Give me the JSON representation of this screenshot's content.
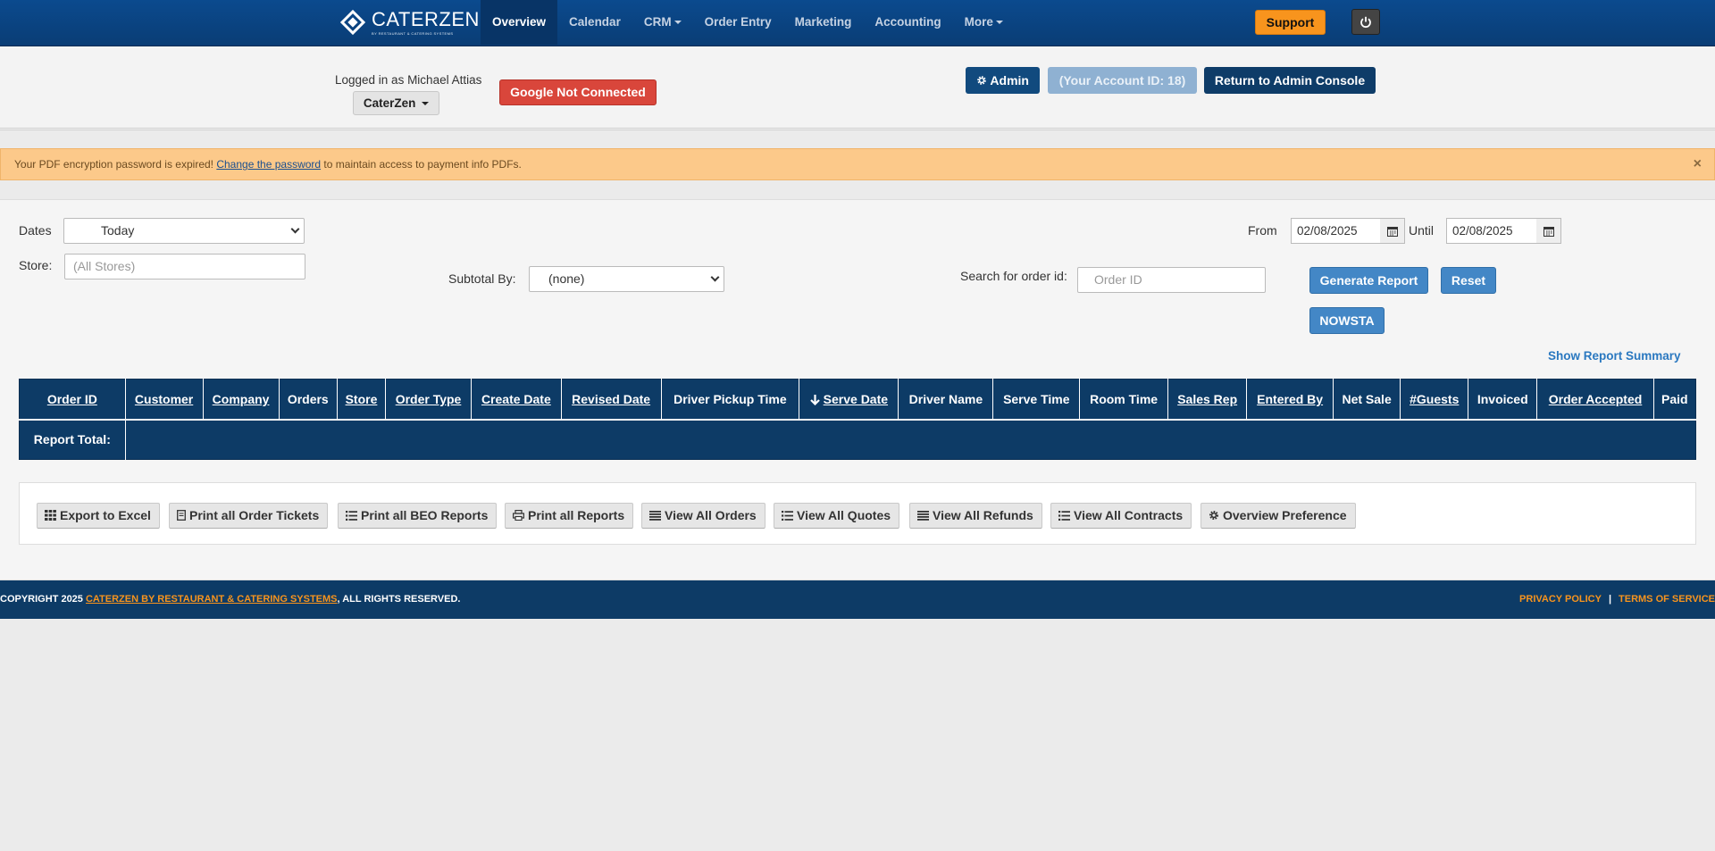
{
  "nav": {
    "logo": {
      "name": "CATERZEN",
      "subtitle": "By RESTAURANT & CATERING SYSTEMS"
    },
    "items": [
      {
        "label": "Overview",
        "active": true
      },
      {
        "label": "Calendar"
      },
      {
        "label": "CRM"
      },
      {
        "label": "Order Entry"
      },
      {
        "label": "Marketing"
      },
      {
        "label": "Accounting"
      },
      {
        "label": "More"
      }
    ],
    "support_label": "Support",
    "power_icon": "power-icon"
  },
  "userbar": {
    "logged_in": "Logged in as Michael Attias",
    "tenant": "CaterZen",
    "google": "Google Not Connected",
    "admin": "Admin",
    "account": "(Your Account ID: 18)",
    "return": "Return to Admin Console"
  },
  "alert": {
    "before": "Your PDF encryption password is expired! ",
    "link": "Change the password",
    "after": " to maintain access to payment info PDFs.",
    "close": "×"
  },
  "filters": {
    "dates_label": "Dates",
    "dates_value": "Today",
    "store_label": "Store:",
    "store_placeholder": "(All Stores)",
    "subtotal_label": "Subtotal By:",
    "subtotal_value": "(none)",
    "search_label": "Search for order id:",
    "search_placeholder": "Order ID",
    "from_label": "From",
    "from_value": "02/08/2025",
    "until_label": "Until",
    "until_value": "02/08/2025",
    "generate": "Generate Report",
    "reset": "Reset",
    "nowsta": "NOWSTA",
    "show_summary": "Show Report Summary"
  },
  "table": {
    "columns": [
      "Order ID",
      "Customer",
      "Company",
      "Orders",
      "Store",
      "Order Type",
      "Create Date",
      "Revised Date",
      "Driver Pickup Time",
      "Serve Date",
      "Driver Name",
      "Serve Time",
      "Room Time",
      "Sales Rep",
      "Entered By",
      "Net Sale",
      "#Guests",
      "Invoiced",
      "Order Accepted",
      "Paid"
    ],
    "total_label": "Report Total:"
  },
  "actions": [
    {
      "label": "Export to Excel",
      "icon": "grid-icon"
    },
    {
      "label": "Print all Order Tickets",
      "icon": "ticket-icon"
    },
    {
      "label": "Print all BEO Reports",
      "icon": "list-icon"
    },
    {
      "label": "Print all Reports",
      "icon": "print-icon"
    },
    {
      "label": "View All Orders",
      "icon": "lines-icon"
    },
    {
      "label": "View All Quotes",
      "icon": "list-icon"
    },
    {
      "label": "View All Refunds",
      "icon": "lines-icon"
    },
    {
      "label": "View All Contracts",
      "icon": "list-icon"
    },
    {
      "label": "Overview Preference",
      "icon": "gear-icon"
    }
  ],
  "footer": {
    "copy_before": "COPYRIGHT 2025 ",
    "copy_link": "CATERZEN BY RESTAURANT & CATERING SYSTEMS",
    "copy_after": ", ALL RIGHTS RESERVED.",
    "privacy": "PRIVACY POLICY",
    "sep": "|",
    "terms": "TERMS OF SERVICE"
  },
  "colors": {
    "nav_bg": "#0b4a8e",
    "accent_orange": "#f8941d",
    "table_header": "#0d3b66",
    "danger": "#d9463b",
    "primary_btn": "#4387c6"
  }
}
